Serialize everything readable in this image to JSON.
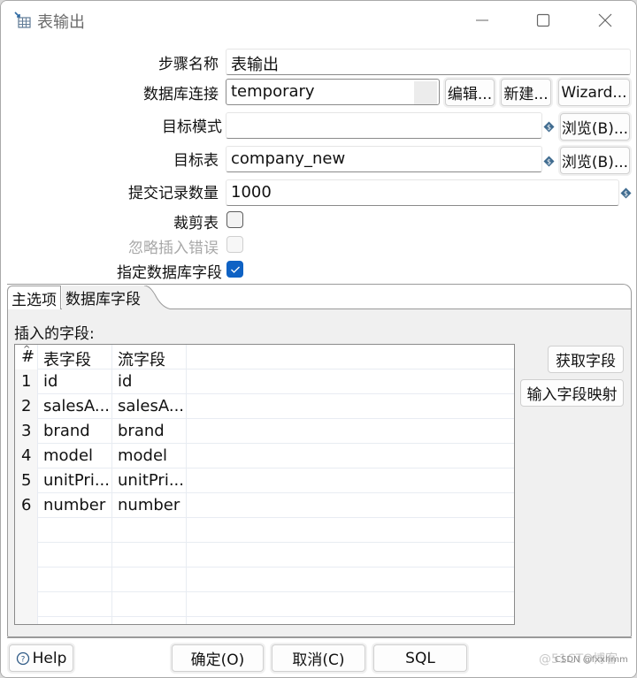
{
  "window": {
    "title": "表输出",
    "icon": "table-output-icon",
    "controls": [
      "minimize",
      "maximize",
      "close"
    ]
  },
  "form": {
    "step_name": {
      "label": "步骤名称",
      "value": "表输出"
    },
    "db_connection": {
      "label": "数据库连接",
      "value": "temporary",
      "edit_button": "编辑...",
      "new_button": "新建...",
      "wizard_button": "Wizard..."
    },
    "target_schema": {
      "label": "目标模式",
      "value": "",
      "browse_button": "浏览(B)..."
    },
    "target_table": {
      "label": "目标表",
      "value": "company_new",
      "browse_button": "浏览(B)..."
    },
    "commit_size": {
      "label": "提交记录数量",
      "value": "1000"
    },
    "truncate_table": {
      "label": "裁剪表",
      "checked": false
    },
    "ignore_insert_errors": {
      "label": "忽略插入错误",
      "checked": false,
      "disabled": true
    },
    "specify_db_fields": {
      "label": "指定数据库字段",
      "checked": true
    }
  },
  "tabs": [
    {
      "label": "主选项",
      "active": false
    },
    {
      "label": "数据库字段",
      "active": true
    }
  ],
  "fields_tab": {
    "insert_label": "插入的字段:",
    "columns": [
      "#",
      "表字段",
      "流字段"
    ],
    "rows": [
      {
        "num": "1",
        "table_field": "id",
        "stream_field": "id"
      },
      {
        "num": "2",
        "table_field": "salesA...",
        "stream_field": "salesA..."
      },
      {
        "num": "3",
        "table_field": "brand",
        "stream_field": "brand"
      },
      {
        "num": "4",
        "table_field": "model",
        "stream_field": "model"
      },
      {
        "num": "5",
        "table_field": "unitPri...",
        "stream_field": "unitPri..."
      },
      {
        "num": "6",
        "table_field": "number",
        "stream_field": "number"
      }
    ],
    "get_fields_button": "获取字段",
    "enter_mapping_button": "输入字段映射"
  },
  "footer": {
    "help_button": "Help",
    "ok_button": "确定(O)",
    "cancel_button": "取消(C)",
    "sql_button": "SQL"
  },
  "watermark": {
    "primary": "@51CTO博客",
    "secondary": "CSDN @fxxhmm"
  },
  "colors": {
    "checkbox_checked": "#0f62c4",
    "variable_icon": "#3f6b8f"
  }
}
